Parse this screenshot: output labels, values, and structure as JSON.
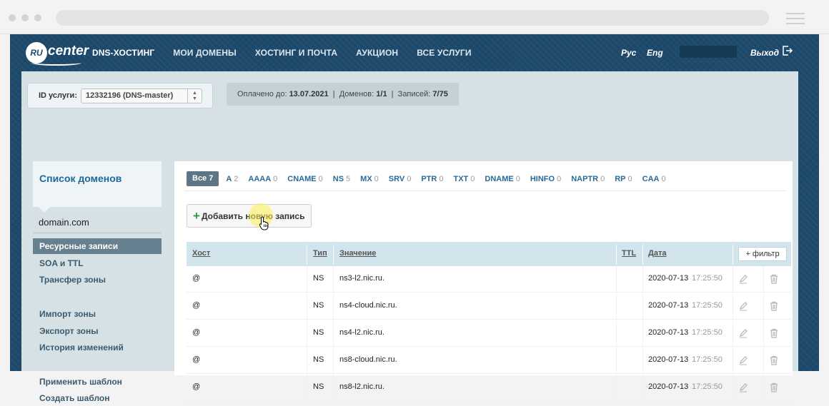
{
  "header": {
    "logo_ru": "RU",
    "logo_center": "center",
    "nav": [
      "DNS-ХОСТИНГ",
      "МОИ ДОМЕНЫ",
      "ХОСТИНГ И ПОЧТА",
      "АУКЦИОН",
      "ВСЕ УСЛУГИ"
    ],
    "lang_ru": "Рус",
    "lang_en": "Eng",
    "logout": "Выход"
  },
  "service": {
    "label": "ID услуги:",
    "selected": "12332196 (DNS-master)"
  },
  "info": {
    "paid_label": "Оплачено до:",
    "paid_value": "13.07.2021",
    "domains_label": "Доменов:",
    "domains_value": "1/1",
    "records_label": "Записей:",
    "records_value": "7/75"
  },
  "sidebar": {
    "title": "Список доменов",
    "domain": "domain.com",
    "items": [
      "Ресурсные записи",
      "SOA и TTL",
      "Трансфер зоны",
      "Импорт зоны",
      "Экспорт зоны",
      "История изменений",
      "Применить шаблон",
      "Создать шаблон"
    ]
  },
  "filters": [
    {
      "label": "Все",
      "count": "7"
    },
    {
      "label": "A",
      "count": "2"
    },
    {
      "label": "AAAA",
      "count": "0"
    },
    {
      "label": "CNAME",
      "count": "0"
    },
    {
      "label": "NS",
      "count": "5"
    },
    {
      "label": "MX",
      "count": "0"
    },
    {
      "label": "SRV",
      "count": "0"
    },
    {
      "label": "PTR",
      "count": "0"
    },
    {
      "label": "TXT",
      "count": "0"
    },
    {
      "label": "DNAME",
      "count": "0"
    },
    {
      "label": "HINFO",
      "count": "0"
    },
    {
      "label": "NAPTR",
      "count": "0"
    },
    {
      "label": "RP",
      "count": "0"
    },
    {
      "label": "CAA",
      "count": "0"
    }
  ],
  "add_button": "Добавить новую запись",
  "table": {
    "columns": {
      "host": "Хост",
      "type": "Тип",
      "value": "Значение",
      "ttl": "TTL",
      "date": "Дата"
    },
    "filter_button": "+ фильтр",
    "rows": [
      {
        "host": "@",
        "type": "NS",
        "value": "ns3-l2.nic.ru.",
        "date": "2020-07-13",
        "time": "17:25:50"
      },
      {
        "host": "@",
        "type": "NS",
        "value": "ns4-cloud.nic.ru.",
        "date": "2020-07-13",
        "time": "17:25:50"
      },
      {
        "host": "@",
        "type": "NS",
        "value": "ns4-l2.nic.ru.",
        "date": "2020-07-13",
        "time": "17:25:50"
      },
      {
        "host": "@",
        "type": "NS",
        "value": "ns8-cloud.nic.ru.",
        "date": "2020-07-13",
        "time": "17:25:50"
      },
      {
        "host": "@",
        "type": "NS",
        "value": "ns8-l2.nic.ru.",
        "date": "2020-07-13",
        "time": "17:25:50"
      }
    ]
  },
  "colors": {
    "header_bg": "#1d4a6c",
    "panel_bg": "#d5e1e5",
    "link_blue": "#2a6a98",
    "active_sidebar": "#67808f",
    "add_plus": "#2c9a45"
  }
}
